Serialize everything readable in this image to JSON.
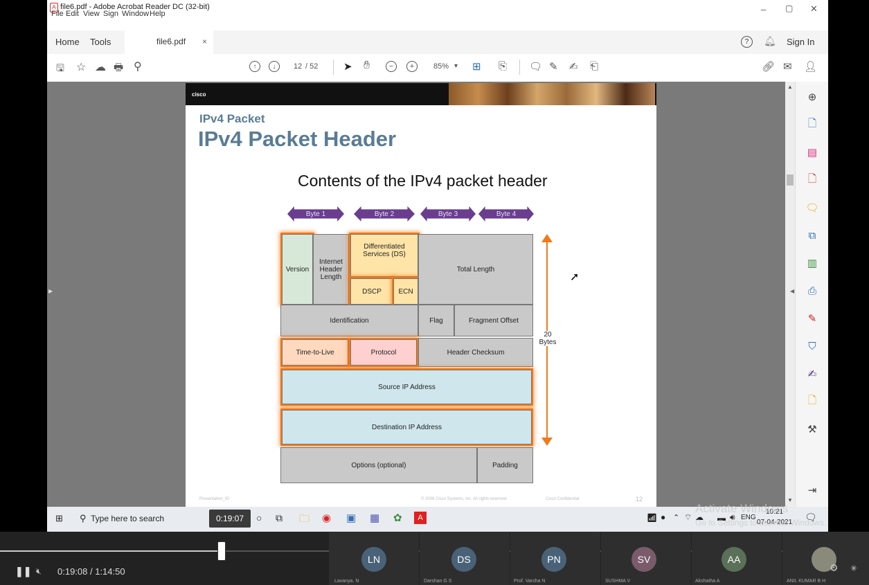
{
  "window": {
    "title": "file6.pdf - Adobe Acrobat Reader DC (32-bit)",
    "minimize": "–",
    "maximize": "▢",
    "close": "✕"
  },
  "menu": [
    "File",
    "Edit",
    "View",
    "Sign",
    "Window",
    "Help"
  ],
  "tabs": {
    "home": "Home",
    "tools": "Tools",
    "file": "file6.pdf",
    "close": "×",
    "help": "?",
    "sign_in": "Sign In"
  },
  "toolbar": {
    "page_current": "12",
    "page_total": "/ 52",
    "zoom": "85%",
    "zoom_caret": "▾"
  },
  "slide": {
    "brand": "cisco",
    "kicker": "IPv4 Packet",
    "title": "IPv4 Packet Header",
    "subtitle": "Contents of the IPv4 packet header",
    "footer_left": "Presentation_ID",
    "footer_center": "© 2008 Cisco Systems, Inc. All rights reserved.",
    "footer_conf": "Cisco Confidential",
    "page_num": "12"
  },
  "diagram": {
    "bytes": [
      "Byte 1",
      "Byte 2",
      "Byte 3",
      "Byte 4"
    ],
    "version": "Version",
    "ihl": "Internet Header Length",
    "ds": "Differentiated Services (DS)",
    "dscp": "DSCP",
    "ecn": "ECN",
    "total_length": "Total Length",
    "identification": "Identification",
    "flag": "Flag",
    "fragment_offset": "Fragment Offset",
    "ttl": "Time-to-Live",
    "protocol": "Protocol",
    "checksum": "Header Checksum",
    "src": "Source IP Address",
    "dst": "Destination IP Address",
    "options": "Options (optional)",
    "padding": "Padding",
    "size_label": "20 Bytes"
  },
  "taskbar": {
    "search": "Type here to search",
    "time_badge": "0:19:07",
    "lang": "ENG",
    "clock_time": "10:21",
    "clock_date": "07-04-2021"
  },
  "watermark": {
    "line1": "Activate Windows",
    "line2": "Go to Settings to activate Windows."
  },
  "player": {
    "time": "0:19:08 / 1:14:50",
    "progress": 0.254
  },
  "participants": [
    {
      "initials": "LN",
      "name": "Lavanya. N",
      "color": "#4a6278"
    },
    {
      "initials": "DS",
      "name": "Darshan G S",
      "color": "#4a6278"
    },
    {
      "initials": "PN",
      "name": "Prof. Varsha N",
      "color": "#4a6278"
    },
    {
      "initials": "SV",
      "name": "SUSHMA V",
      "color": "#7a5b6b"
    },
    {
      "initials": "AA",
      "name": "Akshatha A",
      "color": "#5a7058"
    },
    {
      "initials": "",
      "name": "ANIL KUMAR B H",
      "color": "#6b6b6b"
    }
  ]
}
